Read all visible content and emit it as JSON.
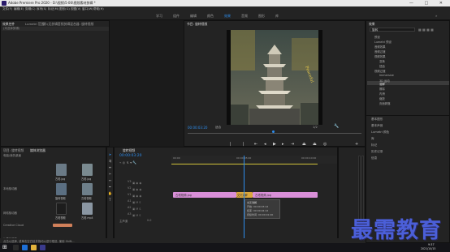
{
  "window": {
    "title": "Adobe Premiere Pro 2020 - D:\\视频\\5-06\\视频素材剪辑 *",
    "controls": [
      "—",
      "□",
      "✕"
    ]
  },
  "menu": [
    "文件(F)",
    "编辑(E)",
    "剪辑(C)",
    "序列(S)",
    "标记(M)",
    "图形(G)",
    "视图(V)",
    "窗口(W)",
    "帮助(H)"
  ],
  "workspaces": [
    "学习",
    "组件",
    "编辑",
    "颜色",
    "效果",
    "音频",
    "图形",
    "库"
  ],
  "source_panel": {
    "tabs": [
      "效果控件",
      "Lumetri 范围",
      "源:(无剪辑)",
      "音频剪辑混合器: 旋转视频",
      "元数据"
    ],
    "placeholder": "(未选择剪辑)"
  },
  "program_monitor": {
    "tab": "节目: 旋转视频",
    "timecode": "00:00:03:20",
    "fit": "适合",
    "resolution": "1/2"
  },
  "effects_panel": {
    "tab": "效果",
    "search_value": "旋转",
    "items": [
      "预设",
      "Lumetri 预设",
      "音频效果",
      "音频过渡",
      "视频效果",
      "变换",
      "扭曲",
      "视频过渡",
      "Immersive",
      "3D 运动",
      "溶解",
      "擦除",
      "内滑",
      "缩放",
      "页面剥落"
    ],
    "sections": [
      "基本图形",
      "基本声音",
      "Lumetri 颜色",
      "库",
      "标记",
      "历史记录",
      "信息"
    ]
  },
  "project_panel": {
    "tabs": [
      "项目: 旋转视频",
      "媒体浏览器"
    ],
    "path_label": "电脑/我的桌面",
    "sidebar": [
      "本地驱动器",
      "网络驱动器",
      "Creative Cloud"
    ],
    "thumbs": [
      {
        "label": "古塔.jpg"
      },
      {
        "label": "古塔.jpg"
      },
      {
        "label": "旋转视频"
      },
      {
        "label": "古塔视频"
      },
      {
        "label": "古塔视频"
      },
      {
        "label": "古塔.mp4"
      }
    ],
    "bottom_text": "1 项已选择"
  },
  "timeline": {
    "tab": "旋转视频",
    "timecode": "00:00:03:20",
    "ruler": [
      "00:00",
      "00:00:05:00",
      "00:00:10:00"
    ],
    "video_tracks": [
      "V3",
      "V2",
      "V1"
    ],
    "audio_tracks": [
      "A1",
      "A2",
      "A3"
    ],
    "master": "主声道",
    "master_value": "0.0",
    "clips": [
      {
        "label": "古塔视频.jpg",
        "color": "#d98fd8"
      },
      {
        "label": "交叉溶解",
        "color": "#d9a63c"
      },
      {
        "label": "古塔视频.jpg",
        "color": "#d98fd8"
      }
    ],
    "tooltip": [
      "交叉溶解",
      "开始: 00:00:03:12",
      "结束: 00:00:04:12",
      "持续时间: 00:00:01:00"
    ]
  },
  "status_bar": "点击以选择, 或单击空白处并拖动以进行框选, 使用 Shift...",
  "taskbar": {
    "time": "9:37",
    "date": "2021/10/15"
  },
  "watermark": "最需教育"
}
